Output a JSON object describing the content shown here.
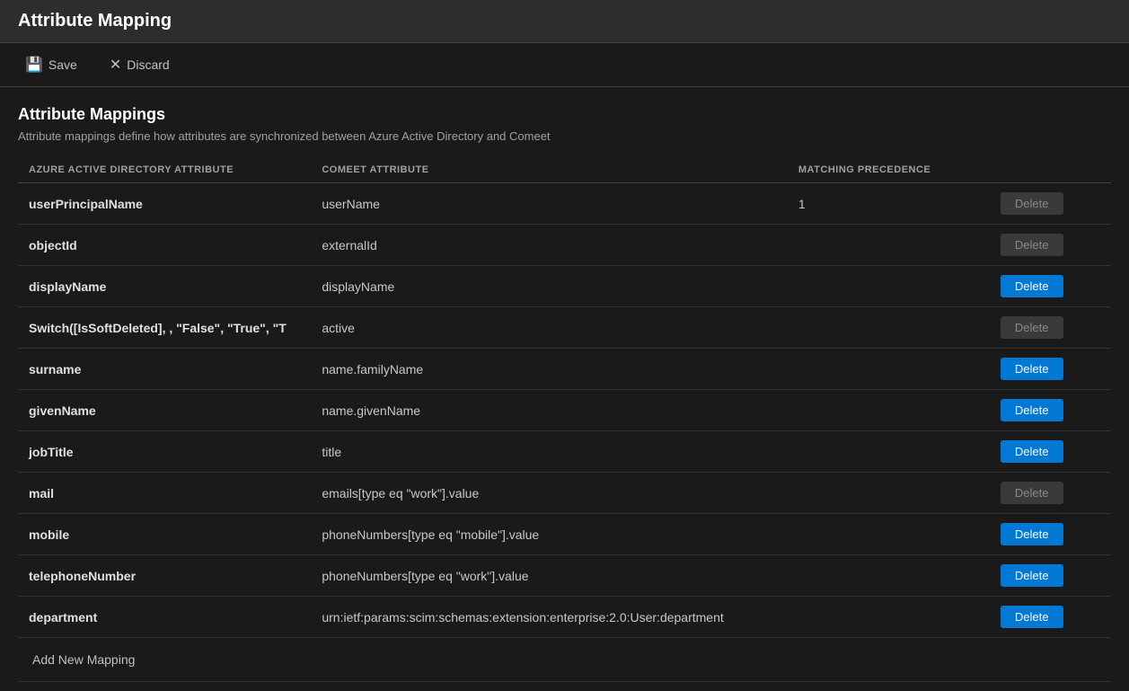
{
  "titleBar": {
    "title": "Attribute Mapping"
  },
  "toolbar": {
    "saveLabel": "Save",
    "discardLabel": "Discard",
    "saveIcon": "💾",
    "discardIcon": "✕"
  },
  "section": {
    "title": "Attribute Mappings",
    "description": "Attribute mappings define how attributes are synchronized between Azure Active Directory and Comeet"
  },
  "table": {
    "columns": [
      "AZURE ACTIVE DIRECTORY ATTRIBUTE",
      "COMEET ATTRIBUTE",
      "MATCHING PRECEDENCE",
      ""
    ],
    "rows": [
      {
        "aad": "userPrincipalName",
        "comeet": "userName",
        "precedence": "1",
        "deleteActive": false
      },
      {
        "aad": "objectId",
        "comeet": "externalId",
        "precedence": "",
        "deleteActive": false
      },
      {
        "aad": "displayName",
        "comeet": "displayName",
        "precedence": "",
        "deleteActive": true
      },
      {
        "aad": "Switch([IsSoftDeleted], , \"False\", \"True\", \"T",
        "comeet": "active",
        "precedence": "",
        "deleteActive": false
      },
      {
        "aad": "surname",
        "comeet": "name.familyName",
        "precedence": "",
        "deleteActive": true
      },
      {
        "aad": "givenName",
        "comeet": "name.givenName",
        "precedence": "",
        "deleteActive": true
      },
      {
        "aad": "jobTitle",
        "comeet": "title",
        "precedence": "",
        "deleteActive": true
      },
      {
        "aad": "mail",
        "comeet": "emails[type eq \"work\"].value",
        "precedence": "",
        "deleteActive": false
      },
      {
        "aad": "mobile",
        "comeet": "phoneNumbers[type eq \"mobile\"].value",
        "precedence": "",
        "deleteActive": true
      },
      {
        "aad": "telephoneNumber",
        "comeet": "phoneNumbers[type eq \"work\"].value",
        "precedence": "",
        "deleteActive": true
      },
      {
        "aad": "department",
        "comeet": "urn:ietf:params:scim:schemas:extension:enterprise:2.0:User:department",
        "precedence": "",
        "deleteActive": true
      }
    ],
    "deleteLabel": "Delete"
  },
  "addNewMapping": {
    "label": "Add New Mapping"
  }
}
